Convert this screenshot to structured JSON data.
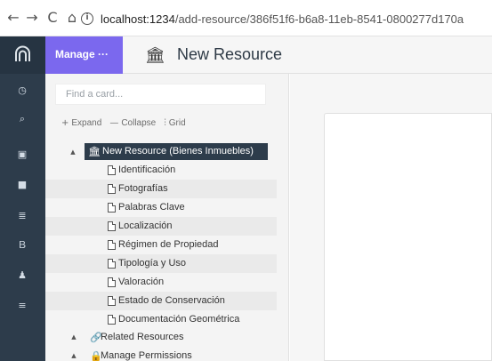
{
  "browser": {
    "back": "←",
    "forward": "→",
    "reload": "C",
    "home": "⌂",
    "info": "i",
    "url_host": "localhost:1234",
    "url_path": "/add-resource/386f51f6-b6a8-11eb-8541-0800277d170a"
  },
  "header": {
    "manage": "Manage ···",
    "title": "New Resource",
    "title_icon": "bank-icon"
  },
  "rail": {
    "items": [
      "logo",
      "clock-icon",
      "search-icon",
      "file-icon",
      "bookmark-icon",
      "table-icon",
      "book-icon",
      "user-icon",
      "menu-icon"
    ]
  },
  "tree_panel": {
    "search_placeholder": "Find a card...",
    "tools": [
      {
        "icon": "+",
        "label": "Expand"
      },
      {
        "icon": "—",
        "label": "Collapse"
      },
      {
        "icon": "⫶",
        "label": "Grid"
      }
    ],
    "root": "New Resource (Bienes Inmuebles)",
    "items": [
      "Identificación",
      "Fotografías",
      "Palabras Clave",
      "Localización",
      "Régimen de Propiedad",
      "Tipología y Uso",
      "Valoración",
      "Estado de Conservación",
      "Documentación Geométrica"
    ],
    "sections": [
      "Related Resources",
      "Manage Permissions"
    ]
  }
}
